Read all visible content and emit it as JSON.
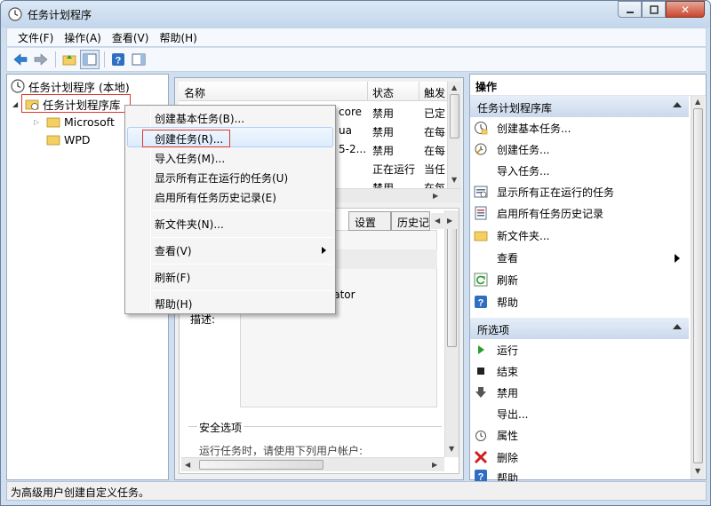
{
  "window": {
    "title": "任务计划程序"
  },
  "menubar": {
    "items": [
      "文件(F)",
      "操作(A)",
      "查看(V)",
      "帮助(H)"
    ]
  },
  "tree": {
    "root": "任务计划程序 (本地)",
    "library": "任务计划程序库",
    "children": [
      "Microsoft",
      "WPD"
    ]
  },
  "task_list": {
    "columns": [
      "名称",
      "状态",
      "触发"
    ],
    "rows": [
      {
        "name": "core",
        "status": "禁用",
        "trigger": "已定"
      },
      {
        "name": "ua",
        "status": "禁用",
        "trigger": "在每"
      },
      {
        "name": "5-2...",
        "status": "禁用",
        "trigger": "在每"
      },
      {
        "name": "",
        "status": "正在运行",
        "trigger": "当任"
      },
      {
        "name": "",
        "status": "禁用",
        "trigger": "在每"
      }
    ]
  },
  "detail": {
    "tabs": [
      "设置",
      "历史记"
    ],
    "author_fragment": "istrator",
    "description_label": "描述:",
    "security_label": "安全选项",
    "security_text": "运行任务时，请使用下列用户帐户:"
  },
  "context_menu": {
    "items": [
      {
        "label": "创建基本任务(B)..."
      },
      {
        "label": "创建任务(R)..."
      },
      {
        "label": "导入任务(M)..."
      },
      {
        "label": "显示所有正在运行的任务(U)"
      },
      {
        "label": "启用所有任务历史记录(E)"
      },
      {
        "label": "新文件夹(N)..."
      },
      {
        "label": "查看(V)"
      },
      {
        "label": "刷新(F)"
      },
      {
        "label": "帮助(H)"
      }
    ]
  },
  "actions": {
    "header": "操作",
    "section1": {
      "title": "任务计划程序库",
      "items": [
        "创建基本任务...",
        "创建任务...",
        "导入任务...",
        "显示所有正在运行的任务",
        "启用所有任务历史记录",
        "新文件夹...",
        "查看",
        "刷新",
        "帮助"
      ]
    },
    "section2": {
      "title": "所选项",
      "items": [
        "运行",
        "结束",
        "禁用",
        "导出...",
        "属性",
        "删除",
        "帮助"
      ]
    }
  },
  "statusbar": {
    "text": "为高级用户创建自定义任务。"
  },
  "colors": {
    "highlight_box": "#e0352b",
    "section_header": "#c9d9ec",
    "run_green": "#2a9d2a",
    "delete_red": "#d02020"
  }
}
